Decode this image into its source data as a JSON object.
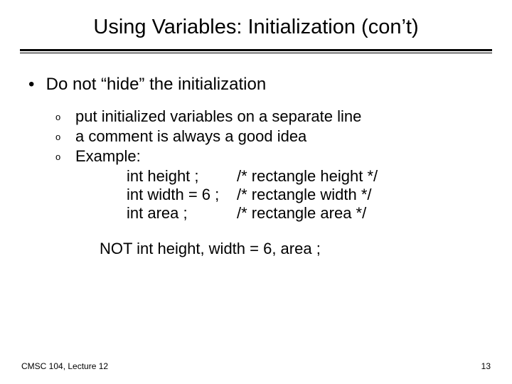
{
  "title": "Using Variables: Initialization (con’t)",
  "bullet1": {
    "marker": "•",
    "text": "Do not “hide” the initialization"
  },
  "sub": {
    "marker": "o",
    "items": [
      "put initialized variables on a separate line",
      "a comment is always a good idea",
      "Example:"
    ]
  },
  "code": [
    {
      "left": "int height ;",
      "right": "/* rectangle height */"
    },
    {
      "left": "int width = 6 ;",
      "right": "/* rectangle width   */"
    },
    {
      "left": "int area ;",
      "right": "/* rectangle area      */"
    }
  ],
  "not_line": "NOT  int height, width = 6, area ;",
  "footer": {
    "left": "CMSC 104, Lecture 12",
    "right": "13"
  }
}
